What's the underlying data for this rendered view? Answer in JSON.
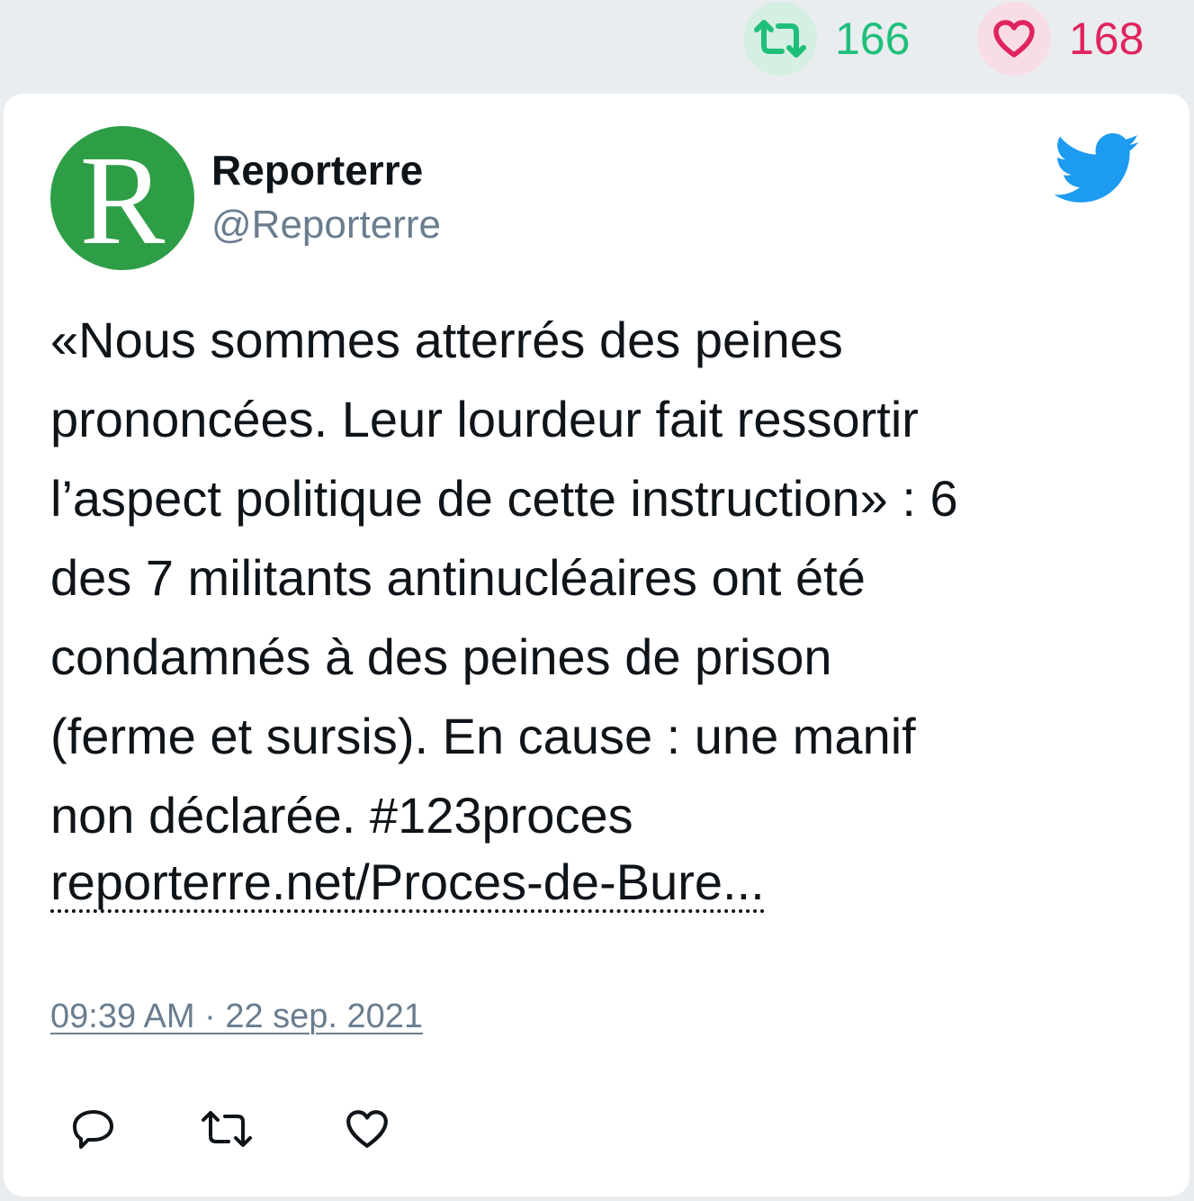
{
  "stats": {
    "retweet_icon": "retweet-icon",
    "retweet_count": "166",
    "retweet_color": "#1fbf7a",
    "like_icon": "heart-icon",
    "like_count": "168",
    "like_color": "#e0245e"
  },
  "tweet": {
    "avatar_letter": "R",
    "avatar_color": "#2e9e46",
    "author_name": "Reporterre",
    "author_handle": "@Reporterre",
    "brand_icon": "twitter-bird-icon",
    "brand_color": "#1d9bf0",
    "text": "«Nous sommes atterrés des peines\nprononcées. Leur lourdeur fait ressortir\nl’aspect politique de cette instruction» : 6\ndes 7 militants antinucléaires ont été\ncondamnés à des peines de prison\n(ferme et sursis). En cause : une manif\nnon déclarée. #123proces",
    "link": "reporterre.net/Proces-de-Bure...",
    "timestamp": "09:39 AM · 22 sep. 2021"
  },
  "actions": [
    {
      "icon": "reply-icon"
    },
    {
      "icon": "retweet-icon"
    },
    {
      "icon": "heart-icon"
    }
  ]
}
